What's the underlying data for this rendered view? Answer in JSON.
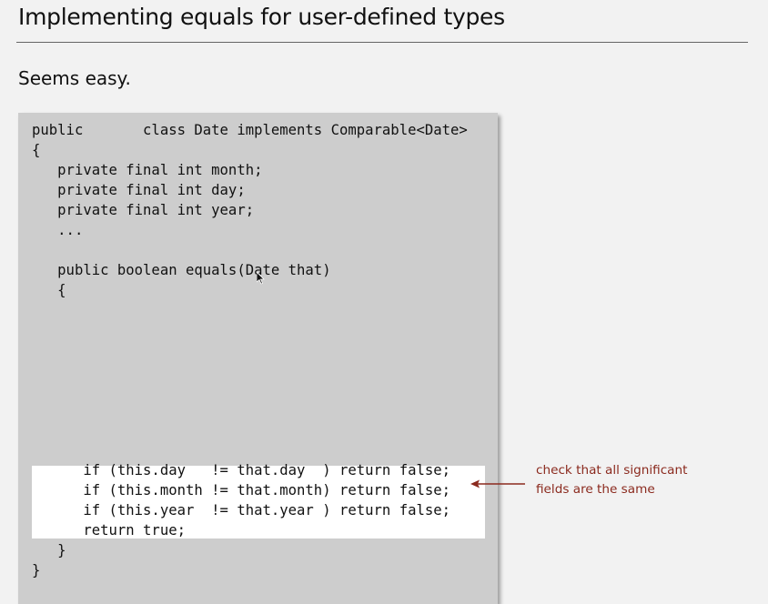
{
  "slide": {
    "title": "Implementing equals for user-defined types",
    "subtitle": "Seems easy."
  },
  "code": {
    "lines": [
      "public       class Date implements Comparable<Date>",
      "{",
      "   private final int month;",
      "   private final int day;",
      "   private final int year;",
      "   ...",
      "",
      "   public boolean equals(Date that)",
      "   {",
      "",
      "",
      "",
      "",
      "",
      "",
      "",
      "",
      "      if (this.day   != that.day  ) return false;",
      "      if (this.month != that.month) return false;",
      "      if (this.year  != that.year ) return false;",
      "      return true;",
      "   }",
      "}"
    ]
  },
  "annotation": {
    "line1": "check that all significant",
    "line2": "fields are the same",
    "color": "#8b2a1e"
  },
  "icons": {
    "pointer": "mouse-cursor-icon",
    "arrow": "arrow-left-icon"
  }
}
